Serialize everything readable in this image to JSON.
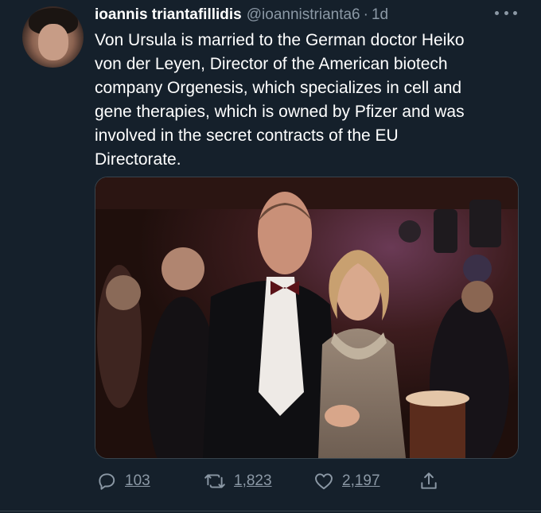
{
  "tweet": {
    "author_name": "ioannis triantafillidis",
    "author_handle": "@ioannistrianta6",
    "separator": "·",
    "time": "1d",
    "text_lines": [
      "Von Ursula is married to the German doctor Heiko",
      "von der Leyen, Director of the American biotech",
      "company Orgenesis, which specializes in cell and",
      "gene therapies, which is owned by Pfizer and was",
      "involved in the secret contracts of the EU",
      "Directorate."
    ]
  },
  "actions": {
    "replies": "103",
    "retweets": "1,823",
    "likes": "2,197"
  },
  "icons": {
    "more": "more-icon",
    "reply": "reply-icon",
    "retweet": "retweet-icon",
    "like": "heart-icon",
    "share": "share-icon"
  },
  "colors": {
    "background": "#15202b",
    "text": "#ffffff",
    "muted": "#8b98a5",
    "border": "#38444d"
  }
}
